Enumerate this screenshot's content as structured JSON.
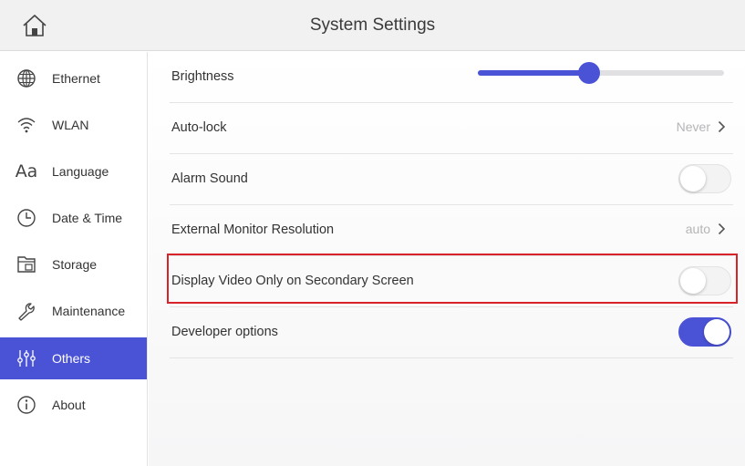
{
  "header": {
    "title": "System Settings",
    "home_icon": "home-icon"
  },
  "sidebar": {
    "items": [
      {
        "label": "Ethernet",
        "icon": "globe-icon",
        "active": false
      },
      {
        "label": "WLAN",
        "icon": "wifi-icon",
        "active": false
      },
      {
        "label": "Language",
        "icon": "language-icon",
        "active": false
      },
      {
        "label": "Date & Time",
        "icon": "clock-icon",
        "active": false
      },
      {
        "label": "Storage",
        "icon": "folder-icon",
        "active": false
      },
      {
        "label": "Maintenance",
        "icon": "wrench-icon",
        "active": false
      },
      {
        "label": "Others",
        "icon": "sliders-icon",
        "active": true
      },
      {
        "label": "About",
        "icon": "info-icon",
        "active": false
      }
    ]
  },
  "settings": {
    "brightness": {
      "label": "Brightness",
      "level": 0.45
    },
    "auto_lock": {
      "label": "Auto-lock",
      "value": "Never"
    },
    "alarm_sound": {
      "label": "Alarm Sound",
      "enabled": false
    },
    "external_monitor_resolution": {
      "label": "External Monitor Resolution",
      "value": "auto"
    },
    "display_video_secondary": {
      "label": "Display Video Only on Secondary Screen",
      "enabled": false,
      "highlighted": true
    },
    "developer_options": {
      "label": "Developer options",
      "enabled": true
    }
  },
  "colors": {
    "accent": "#4a52d6",
    "highlight_border": "#d8232a"
  }
}
